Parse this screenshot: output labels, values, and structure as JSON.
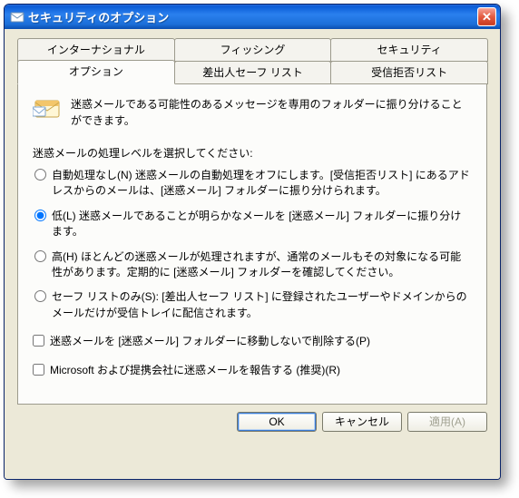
{
  "title": "セキュリティのオプション",
  "tabs": {
    "row1": [
      {
        "label": "インターナショナル"
      },
      {
        "label": "フィッシング"
      },
      {
        "label": "セキュリティ"
      }
    ],
    "row2": [
      {
        "label": "オプション",
        "active": true
      },
      {
        "label": "差出人セーフ リスト"
      },
      {
        "label": "受信拒否リスト"
      }
    ]
  },
  "intro": "迷惑メールである可能性のあるメッセージを専用のフォルダーに振り分けることができます。",
  "section_label": "迷惑メールの処理レベルを選択してください:",
  "radios": [
    {
      "text": "自動処理なし(N) 迷惑メールの自動処理をオフにします。[受信拒否リスト] にあるアドレスからのメールは、[迷惑メール] フォルダーに振り分けられます。",
      "checked": false
    },
    {
      "text": "低(L) 迷惑メールであることが明らかなメールを [迷惑メール] フォルダーに振り分けます。",
      "checked": true
    },
    {
      "text": "高(H) ほとんどの迷惑メールが処理されますが、通常のメールもその対象になる可能性があります。定期的に [迷惑メール] フォルダーを確認してください。",
      "checked": false
    },
    {
      "text": "セーフ リストのみ(S): [差出人セーフ リスト] に登録されたユーザーやドメインからのメールだけが受信トレイに配信されます。",
      "checked": false
    }
  ],
  "checks": [
    {
      "text": "迷惑メールを [迷惑メール] フォルダーに移動しないで削除する(P)",
      "checked": false
    },
    {
      "text": "Microsoft および提携会社に迷惑メールを報告する (推奨)(R)",
      "checked": false
    }
  ],
  "buttons": {
    "ok": "OK",
    "cancel": "キャンセル",
    "apply": "適用(A)"
  },
  "icons": {
    "title_icon": "mail-options",
    "close": "✕"
  }
}
